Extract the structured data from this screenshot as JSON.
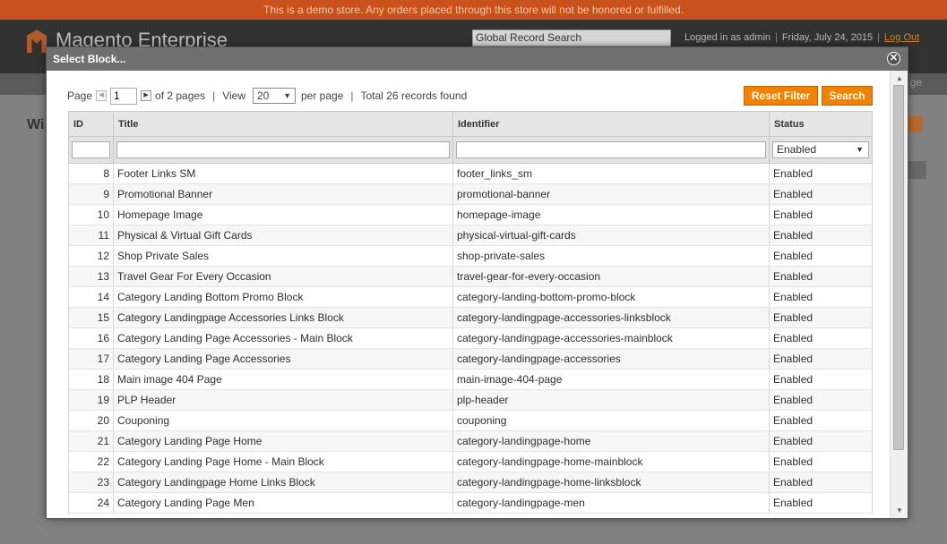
{
  "banner": {
    "text": "This is a demo store. Any orders placed through this store will not be honored or fulfilled."
  },
  "header": {
    "logo_text": "Magento Enterprise",
    "search_value": "Global Record Search",
    "logged_in": "Logged in as admin",
    "date": "Friday, July 24, 2015",
    "logout": "Log Out",
    "nav_partial": "ge"
  },
  "background": {
    "page_title_partial": "Wi"
  },
  "modal": {
    "title": "Select Block...",
    "close_icon": "close-icon",
    "pager": {
      "page_label": "Page",
      "page_value": "1",
      "of_pages": "of 2 pages",
      "view_label": "View",
      "view_value": "20",
      "per_page": "per page",
      "total": "Total 26 records found"
    },
    "buttons": {
      "reset_filter": "Reset Filter",
      "search": "Search"
    },
    "columns": {
      "id": "ID",
      "title": "Title",
      "identifier": "Identifier",
      "status": "Status"
    },
    "filter": {
      "status_value": "Enabled"
    },
    "rows": [
      {
        "id": "8",
        "title": "Footer Links SM",
        "identifier": "footer_links_sm",
        "status": "Enabled"
      },
      {
        "id": "9",
        "title": "Promotional Banner",
        "identifier": "promotional-banner",
        "status": "Enabled"
      },
      {
        "id": "10",
        "title": "Homepage Image",
        "identifier": "homepage-image",
        "status": "Enabled"
      },
      {
        "id": "11",
        "title": "Physical & Virtual Gift Cards",
        "identifier": "physical-virtual-gift-cards",
        "status": "Enabled"
      },
      {
        "id": "12",
        "title": "Shop Private Sales",
        "identifier": "shop-private-sales",
        "status": "Enabled"
      },
      {
        "id": "13",
        "title": "Travel Gear For Every Occasion",
        "identifier": "travel-gear-for-every-occasion",
        "status": "Enabled"
      },
      {
        "id": "14",
        "title": "Category Landing Bottom Promo Block",
        "identifier": "category-landing-bottom-promo-block",
        "status": "Enabled"
      },
      {
        "id": "15",
        "title": "Category Landingpage Accessories Links Block",
        "identifier": "category-landingpage-accessories-linksblock",
        "status": "Enabled"
      },
      {
        "id": "16",
        "title": "Category Landing Page Accessories - Main Block",
        "identifier": "category-landingpage-accessories-mainblock",
        "status": "Enabled"
      },
      {
        "id": "17",
        "title": "Category Landing Page Accessories",
        "identifier": "category-landingpage-accessories",
        "status": "Enabled"
      },
      {
        "id": "18",
        "title": "Main image 404 Page",
        "identifier": "main-image-404-page",
        "status": "Enabled"
      },
      {
        "id": "19",
        "title": "PLP Header",
        "identifier": "plp-header",
        "status": "Enabled"
      },
      {
        "id": "20",
        "title": "Couponing",
        "identifier": "couponing",
        "status": "Enabled"
      },
      {
        "id": "21",
        "title": "Category Landing Page Home",
        "identifier": "category-landingpage-home",
        "status": "Enabled"
      },
      {
        "id": "22",
        "title": "Category Landing Page Home - Main Block",
        "identifier": "category-landingpage-home-mainblock",
        "status": "Enabled"
      },
      {
        "id": "23",
        "title": "Category Landingpage Home Links Block",
        "identifier": "category-landingpage-home-linksblock",
        "status": "Enabled"
      },
      {
        "id": "24",
        "title": "Category Landing Page Men",
        "identifier": "category-landingpage-men",
        "status": "Enabled"
      }
    ]
  }
}
